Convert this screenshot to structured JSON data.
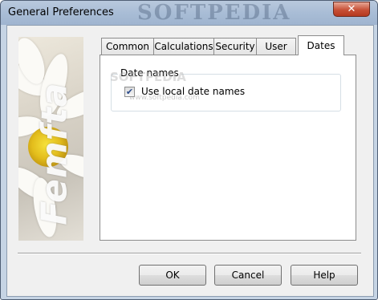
{
  "window": {
    "title": "General Preferences",
    "close_glyph": "✕",
    "watermark": "SOFTPEDIA"
  },
  "banner": {
    "text": "Femfta"
  },
  "tabs": [
    {
      "label": "Common",
      "active": false
    },
    {
      "label": "Calculations",
      "active": false
    },
    {
      "label": "Security",
      "active": false
    },
    {
      "label": "User",
      "active": false
    },
    {
      "label": "Dates",
      "active": true
    }
  ],
  "dates_panel": {
    "group_title": "Date names",
    "use_local_label": "Use local date names",
    "use_local_checked": true,
    "watermark_text": "SOFTPEDIA",
    "watermark_url": "www.softpedia.com"
  },
  "buttons": {
    "ok": "OK",
    "cancel": "Cancel",
    "help": "Help"
  }
}
